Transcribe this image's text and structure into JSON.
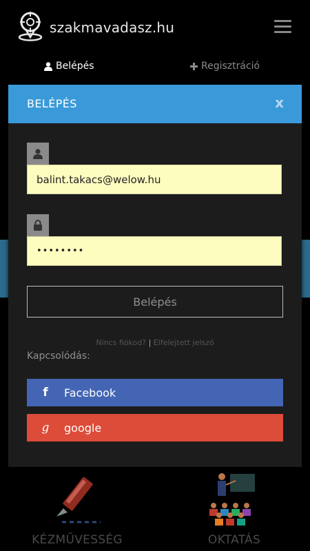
{
  "header": {
    "site_name": "szakmavadasz.hu",
    "logo_icon": "location-pin-crosshair-icon",
    "menu_icon": "hamburger-menu-icon"
  },
  "tabs": [
    {
      "label": "Belépés",
      "icon": "user-icon",
      "active": true
    },
    {
      "label": "Regisztráció",
      "icon": "plus-icon",
      "active": false
    }
  ],
  "modal": {
    "title": "BELÉPÉS",
    "close_label": "x",
    "email": {
      "value": "balint.takacs@welow.hu",
      "icon": "user-icon"
    },
    "password": {
      "value": "••••••••",
      "icon": "lock-icon"
    },
    "submit_label": "Belépés",
    "no_account_link": "Nincs fiókod?",
    "separator": "|",
    "forgot_link": "Elfelejtett jelszó",
    "connect_label": "Kapcsolódás:",
    "facebook": {
      "icon_char": "f",
      "label": "Facebook",
      "color": "#4365b4"
    },
    "google": {
      "icon_char": "g",
      "label": "google",
      "color": "#dd4b39"
    }
  },
  "categories": [
    {
      "label": "KÉZMŰVESSÉG",
      "icon": "craft-knife-icon"
    },
    {
      "label": "OKTATÁS",
      "icon": "classroom-teacher-icon"
    }
  ],
  "colors": {
    "accent": "#3a9ad9",
    "input_bg": "#fdfdc0",
    "modal_bg": "#1c1c1c"
  }
}
